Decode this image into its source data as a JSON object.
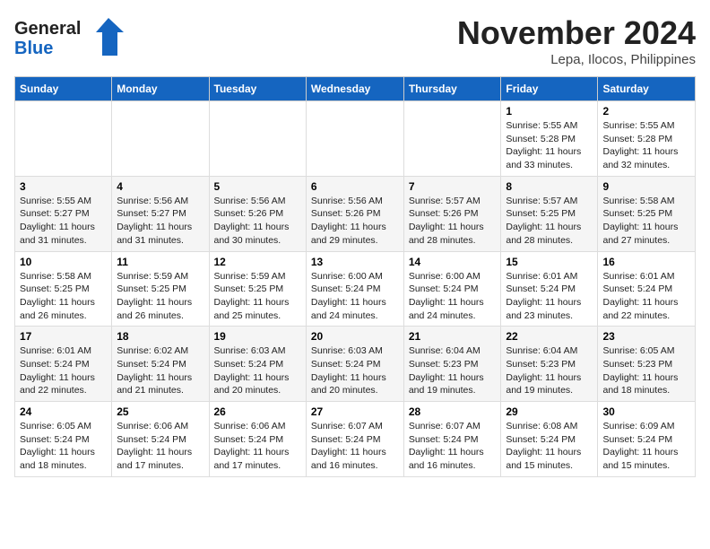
{
  "header": {
    "logo_general": "General",
    "logo_blue": "Blue",
    "month": "November 2024",
    "location": "Lepa, Ilocos, Philippines"
  },
  "weekdays": [
    "Sunday",
    "Monday",
    "Tuesday",
    "Wednesday",
    "Thursday",
    "Friday",
    "Saturday"
  ],
  "weeks": [
    [
      {
        "day": "",
        "info": ""
      },
      {
        "day": "",
        "info": ""
      },
      {
        "day": "",
        "info": ""
      },
      {
        "day": "",
        "info": ""
      },
      {
        "day": "",
        "info": ""
      },
      {
        "day": "1",
        "info": "Sunrise: 5:55 AM\nSunset: 5:28 PM\nDaylight: 11 hours and 33 minutes."
      },
      {
        "day": "2",
        "info": "Sunrise: 5:55 AM\nSunset: 5:28 PM\nDaylight: 11 hours and 32 minutes."
      }
    ],
    [
      {
        "day": "3",
        "info": "Sunrise: 5:55 AM\nSunset: 5:27 PM\nDaylight: 11 hours and 31 minutes."
      },
      {
        "day": "4",
        "info": "Sunrise: 5:56 AM\nSunset: 5:27 PM\nDaylight: 11 hours and 31 minutes."
      },
      {
        "day": "5",
        "info": "Sunrise: 5:56 AM\nSunset: 5:26 PM\nDaylight: 11 hours and 30 minutes."
      },
      {
        "day": "6",
        "info": "Sunrise: 5:56 AM\nSunset: 5:26 PM\nDaylight: 11 hours and 29 minutes."
      },
      {
        "day": "7",
        "info": "Sunrise: 5:57 AM\nSunset: 5:26 PM\nDaylight: 11 hours and 28 minutes."
      },
      {
        "day": "8",
        "info": "Sunrise: 5:57 AM\nSunset: 5:25 PM\nDaylight: 11 hours and 28 minutes."
      },
      {
        "day": "9",
        "info": "Sunrise: 5:58 AM\nSunset: 5:25 PM\nDaylight: 11 hours and 27 minutes."
      }
    ],
    [
      {
        "day": "10",
        "info": "Sunrise: 5:58 AM\nSunset: 5:25 PM\nDaylight: 11 hours and 26 minutes."
      },
      {
        "day": "11",
        "info": "Sunrise: 5:59 AM\nSunset: 5:25 PM\nDaylight: 11 hours and 26 minutes."
      },
      {
        "day": "12",
        "info": "Sunrise: 5:59 AM\nSunset: 5:25 PM\nDaylight: 11 hours and 25 minutes."
      },
      {
        "day": "13",
        "info": "Sunrise: 6:00 AM\nSunset: 5:24 PM\nDaylight: 11 hours and 24 minutes."
      },
      {
        "day": "14",
        "info": "Sunrise: 6:00 AM\nSunset: 5:24 PM\nDaylight: 11 hours and 24 minutes."
      },
      {
        "day": "15",
        "info": "Sunrise: 6:01 AM\nSunset: 5:24 PM\nDaylight: 11 hours and 23 minutes."
      },
      {
        "day": "16",
        "info": "Sunrise: 6:01 AM\nSunset: 5:24 PM\nDaylight: 11 hours and 22 minutes."
      }
    ],
    [
      {
        "day": "17",
        "info": "Sunrise: 6:01 AM\nSunset: 5:24 PM\nDaylight: 11 hours and 22 minutes."
      },
      {
        "day": "18",
        "info": "Sunrise: 6:02 AM\nSunset: 5:24 PM\nDaylight: 11 hours and 21 minutes."
      },
      {
        "day": "19",
        "info": "Sunrise: 6:03 AM\nSunset: 5:24 PM\nDaylight: 11 hours and 20 minutes."
      },
      {
        "day": "20",
        "info": "Sunrise: 6:03 AM\nSunset: 5:24 PM\nDaylight: 11 hours and 20 minutes."
      },
      {
        "day": "21",
        "info": "Sunrise: 6:04 AM\nSunset: 5:23 PM\nDaylight: 11 hours and 19 minutes."
      },
      {
        "day": "22",
        "info": "Sunrise: 6:04 AM\nSunset: 5:23 PM\nDaylight: 11 hours and 19 minutes."
      },
      {
        "day": "23",
        "info": "Sunrise: 6:05 AM\nSunset: 5:23 PM\nDaylight: 11 hours and 18 minutes."
      }
    ],
    [
      {
        "day": "24",
        "info": "Sunrise: 6:05 AM\nSunset: 5:24 PM\nDaylight: 11 hours and 18 minutes."
      },
      {
        "day": "25",
        "info": "Sunrise: 6:06 AM\nSunset: 5:24 PM\nDaylight: 11 hours and 17 minutes."
      },
      {
        "day": "26",
        "info": "Sunrise: 6:06 AM\nSunset: 5:24 PM\nDaylight: 11 hours and 17 minutes."
      },
      {
        "day": "27",
        "info": "Sunrise: 6:07 AM\nSunset: 5:24 PM\nDaylight: 11 hours and 16 minutes."
      },
      {
        "day": "28",
        "info": "Sunrise: 6:07 AM\nSunset: 5:24 PM\nDaylight: 11 hours and 16 minutes."
      },
      {
        "day": "29",
        "info": "Sunrise: 6:08 AM\nSunset: 5:24 PM\nDaylight: 11 hours and 15 minutes."
      },
      {
        "day": "30",
        "info": "Sunrise: 6:09 AM\nSunset: 5:24 PM\nDaylight: 11 hours and 15 minutes."
      }
    ]
  ]
}
